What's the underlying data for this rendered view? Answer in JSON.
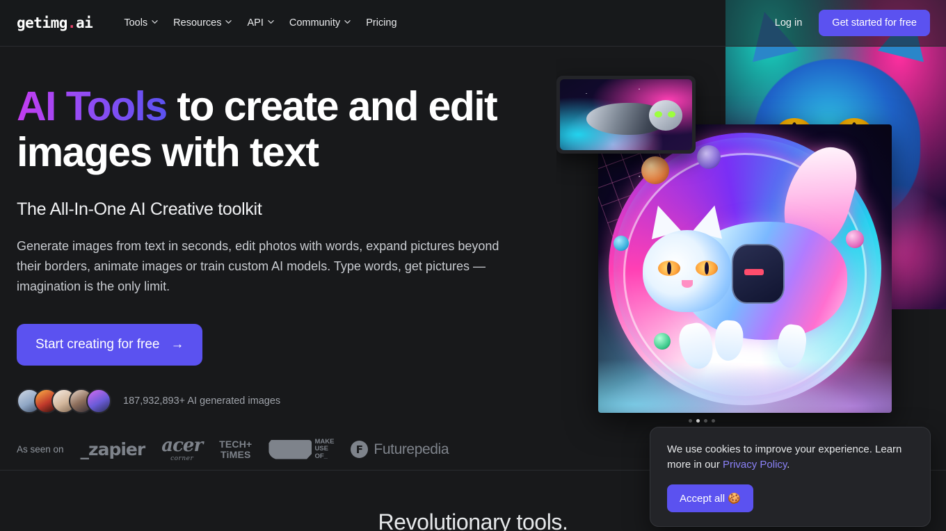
{
  "nav": {
    "logo_text": "getimg",
    "logo_dot": ".",
    "logo_suffix": "ai",
    "items": [
      {
        "label": "Tools",
        "has_chevron": true
      },
      {
        "label": "Resources",
        "has_chevron": true
      },
      {
        "label": "API",
        "has_chevron": true
      },
      {
        "label": "Community",
        "has_chevron": true
      },
      {
        "label": "Pricing",
        "has_chevron": false
      }
    ],
    "login_label": "Log in",
    "cta_label": "Get started for free"
  },
  "hero": {
    "headline_highlight": "AI Tools",
    "headline_rest": " to create and edit images with text",
    "subhead": "The All-In-One AI Creative toolkit",
    "lede": "Generate images from text in seconds, edit photos with words, expand pictures beyond their borders, animate images or train custom AI models. Type words, get pictures — imagination is the only limit.",
    "cta_label": "Start creating for free",
    "cta_arrow": "→",
    "social_proof": "187,932,893+ AI generated images",
    "carousel_dots": 4,
    "carousel_active_index": 1
  },
  "seen_on": {
    "label": "As seen on",
    "brands": [
      {
        "name": "zapier",
        "text": "_zapier"
      },
      {
        "name": "acer-corner",
        "main": "acer",
        "sub": "corner"
      },
      {
        "name": "tech-times",
        "line1": "TECH+",
        "line2": "TiMES"
      },
      {
        "name": "makeuseof",
        "l1": "MAKE",
        "l2": "USE",
        "l3": "OF_"
      },
      {
        "name": "futurepedia",
        "mark": "F",
        "text": "Futurepedia"
      }
    ]
  },
  "section2": {
    "title": "Revolutionary tools."
  },
  "cookie": {
    "text_before": "We use cookies to improve your experience. Learn more in our ",
    "link_label": "Privacy Policy",
    "text_after": ".",
    "accept_label": "Accept all 🍪"
  },
  "colors": {
    "background": "#18191b",
    "accent": "#5b52f0",
    "logo_dot": "#e8416b",
    "link": "#8b82f8",
    "muted_text": "#9ea2a9"
  }
}
